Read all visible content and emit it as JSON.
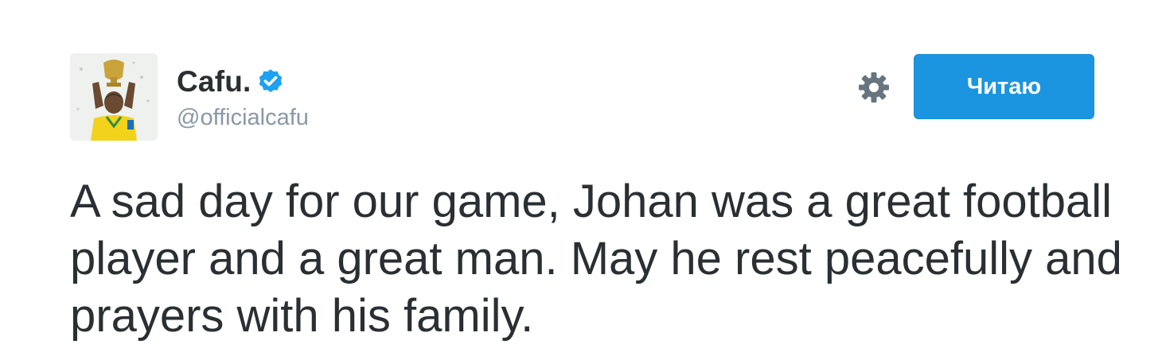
{
  "tweet": {
    "author": {
      "name": "Cafu.",
      "handle": "@officialcafu",
      "verified": true,
      "avatar_icon": "player-with-trophy-avatar"
    },
    "follow_button_label": "Читаю",
    "settings_icon": "gear-icon",
    "text": "A sad day for our game, Johan was a great football player and a great man. May he rest peacefully and prayers with his family."
  },
  "colors": {
    "accent": "#1b95e0",
    "verified": "#1da1f2",
    "text": "#292f33",
    "muted": "#8899a6",
    "icon": "#66757f"
  }
}
